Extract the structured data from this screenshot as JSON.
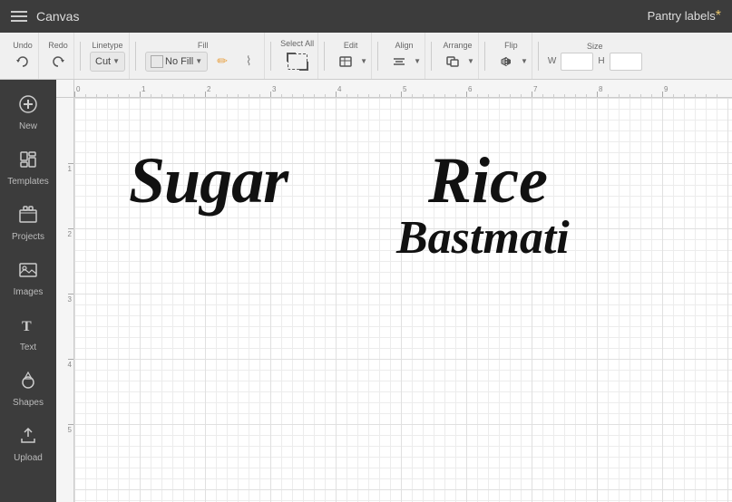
{
  "topbar": {
    "title": "Canvas",
    "brand": "Pantry labels",
    "brand_asterisk": "*"
  },
  "toolbar": {
    "undo_label": "Undo",
    "redo_label": "Redo",
    "linetype_label": "Linetype",
    "linetype_value": "Cut",
    "fill_label": "Fill",
    "fill_value": "No Fill",
    "select_all_label": "Select All",
    "edit_label": "Edit",
    "align_label": "Align",
    "arrange_label": "Arrange",
    "flip_label": "Flip",
    "size_label": "Size",
    "size_w": "W",
    "size_h": "H"
  },
  "sidebar": {
    "items": [
      {
        "label": "New",
        "icon": "plus-circle"
      },
      {
        "label": "Templates",
        "icon": "templates"
      },
      {
        "label": "Projects",
        "icon": "projects"
      },
      {
        "label": "Images",
        "icon": "images"
      },
      {
        "label": "Text",
        "icon": "text"
      },
      {
        "label": "Shapes",
        "icon": "shapes"
      },
      {
        "label": "Upload",
        "icon": "upload"
      }
    ]
  },
  "canvas": {
    "text1": "Sugar",
    "text2": "Rice",
    "text3": "Bastmati",
    "ruler_h": [
      "0",
      "1",
      "2",
      "3",
      "4",
      "5",
      "6",
      "7",
      "8",
      "9"
    ],
    "ruler_v": [
      "1",
      "2",
      "3",
      "4",
      "5"
    ]
  }
}
